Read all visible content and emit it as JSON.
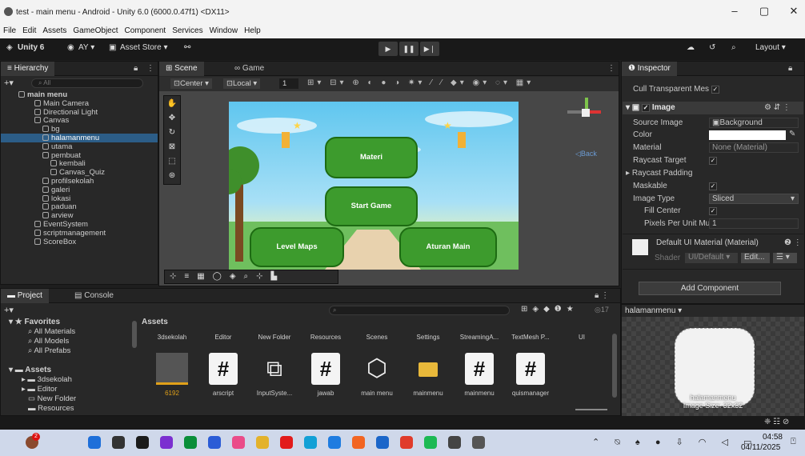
{
  "window": {
    "title": "test - main menu - Android - Unity 6.0 (6000.0.47f1) <DX11>",
    "controls": [
      "–",
      "▢",
      "✕"
    ]
  },
  "menu": [
    "File",
    "Edit",
    "Assets",
    "GameObject",
    "Component",
    "Services",
    "Window",
    "Help"
  ],
  "toolbar": {
    "unity_label": "Unity 6",
    "account": "AY ▾",
    "asset_store": "Asset Store ▾",
    "layout": "Layout ▾"
  },
  "hierarchy": {
    "tab": "Hierarchy",
    "search_placeholder": "All",
    "items": [
      {
        "label": "main menu",
        "indent": 0
      },
      {
        "label": "Main Camera",
        "indent": 2
      },
      {
        "label": "Directional Light",
        "indent": 2
      },
      {
        "label": "Canvas",
        "indent": 2
      },
      {
        "label": "bg",
        "indent": 3
      },
      {
        "label": "halamanmenu",
        "indent": 3,
        "selected": true
      },
      {
        "label": "utama",
        "indent": 3
      },
      {
        "label": "pembuat",
        "indent": 3
      },
      {
        "label": "kembali",
        "indent": 4
      },
      {
        "label": "Canvas_Quiz",
        "indent": 4
      },
      {
        "label": "profilsekolah",
        "indent": 3
      },
      {
        "label": "galeri",
        "indent": 3
      },
      {
        "label": "lokasi",
        "indent": 3
      },
      {
        "label": "paduan",
        "indent": 3
      },
      {
        "label": "arview",
        "indent": 3
      },
      {
        "label": "EventSystem",
        "indent": 2
      },
      {
        "label": "scriptmanagement",
        "indent": 2
      },
      {
        "label": "ScoreBox",
        "indent": 2
      }
    ]
  },
  "scene": {
    "tabs": [
      "Scene",
      "Game"
    ],
    "pivot": "Center ▾",
    "space": "Local ▾",
    "grid_value": "1",
    "back_label": "◁Back",
    "buttons": {
      "materi": "Materi",
      "start": "Start Game",
      "level": "Level Maps",
      "aturan": "Aturan Main"
    }
  },
  "inspector": {
    "tab": "Inspector",
    "cull_label": "Cull Transparent Mes",
    "component": "Image",
    "rows": {
      "source_image": "Source Image",
      "source_image_val": "Background",
      "color": "Color",
      "material": "Material",
      "material_val": "None (Material)",
      "raycast_target": "Raycast Target",
      "raycast_padding": "Raycast Padding",
      "maskable": "Maskable",
      "image_type": "Image Type",
      "image_type_val": "Sliced",
      "fill_center": "Fill Center",
      "ppu": "Pixels Per Unit Mu",
      "ppu_val": "1"
    },
    "material_name": "Default UI Material (Material)",
    "shader_label": "Shader",
    "shader_val": "UI/Default ▾",
    "edit_btn": "Edit...",
    "add_component": "Add Component",
    "preview_name": "halamanmenu ▾",
    "preview_caption": "halamanmenu",
    "preview_size": "Image Size: 32x32"
  },
  "project": {
    "tabs": [
      "Project",
      "Console"
    ],
    "favorites": "Favorites",
    "fav_items": [
      "All Materials",
      "All Models",
      "All Prefabs"
    ],
    "assets_root": "Assets",
    "tree": [
      "3dsekolah",
      "Editor",
      "New Folder",
      "Resources"
    ],
    "breadcrumb": "Assets",
    "folders": [
      "3dsekolah",
      "Editor",
      "New Folder",
      "Resources",
      "Scenes",
      "Settings",
      "StreamingA...",
      "TextMesh P...",
      "UI"
    ],
    "files": [
      {
        "name": "6192",
        "kind": "audio"
      },
      {
        "name": "arscript",
        "kind": "cs"
      },
      {
        "name": "InputSyste...",
        "kind": "input"
      },
      {
        "name": "jawab",
        "kind": "cs"
      },
      {
        "name": "main menu",
        "kind": "unity"
      },
      {
        "name": "mainmenu",
        "kind": "folder"
      },
      {
        "name": "mainmenu",
        "kind": "cs"
      },
      {
        "name": "quismanager",
        "kind": "cs"
      }
    ],
    "count": "17"
  },
  "taskbar": {
    "time": "04:58",
    "date": "04/11/2025",
    "badge": "2"
  }
}
